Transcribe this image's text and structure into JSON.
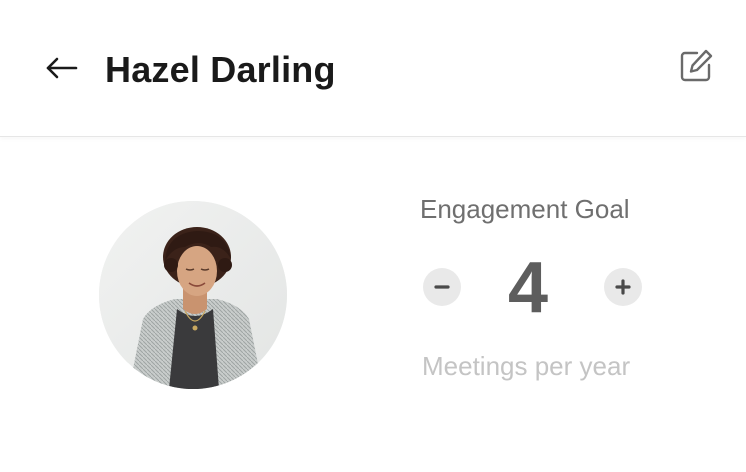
{
  "header": {
    "title": "Hazel Darling",
    "back_icon": "arrow-left-icon",
    "edit_icon": "edit-icon"
  },
  "profile": {
    "avatar_description": "profile-photo"
  },
  "engagement": {
    "label": "Engagement Goal",
    "value": "4",
    "unit_label": "Meetings per year",
    "decrement_icon": "minus-icon",
    "increment_icon": "plus-icon"
  },
  "colors": {
    "title": "#1a1a1a",
    "label": "#6f6f6f",
    "value": "#5d5d5d",
    "muted": "#c4c4c4",
    "stepper_bg": "#e9e9e9"
  }
}
